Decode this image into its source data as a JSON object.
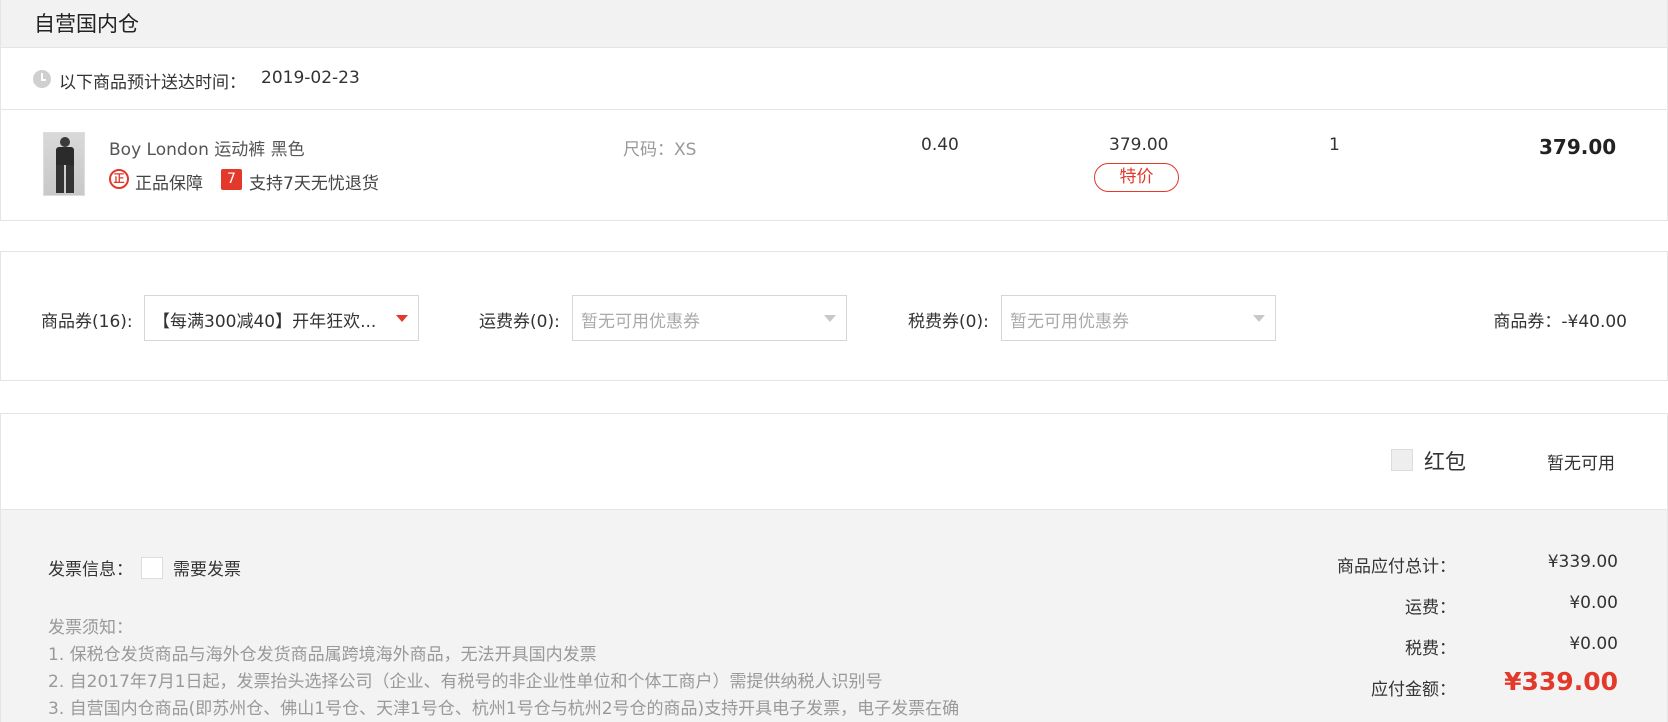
{
  "warehouse": {
    "title": "自营国内仓"
  },
  "delivery": {
    "label": "以下商品预计送达时间：",
    "date": "2019-02-23"
  },
  "product": {
    "name": "Boy London 运动裤 黑色",
    "guarantee_icon": "正",
    "guarantee_label": "正品保障",
    "return_icon": "7",
    "return_label": "支持7天无忧退货",
    "size": "尺码：XS",
    "weight": "0.40",
    "unit_price": "379.00",
    "special_badge": "特价",
    "quantity": "1",
    "total": "379.00"
  },
  "coupons": {
    "goods": {
      "label": "商品券(16):",
      "value": "【每满300减40】开年狂欢..."
    },
    "shipping": {
      "label": "运费券(0):",
      "value": "暂无可用优惠券"
    },
    "tax": {
      "label": "税费券(0):",
      "value": "暂无可用优惠券"
    },
    "summary": "商品券：-¥40.00"
  },
  "red_packet": {
    "label": "红包",
    "status": "暂无可用"
  },
  "invoice": {
    "label": "发票信息：",
    "need_label": "需要发票",
    "notice_title": "发票须知：",
    "notices": [
      "1. 保税仓发货商品与海外仓发货商品属跨境海外商品，无法开具国内发票",
      "2. 自2017年7月1日起，发票抬头选择公司（企业、有税号的非企业性单位和个体工商户）需提供纳税人识别号",
      "3. 自营国内仓商品(即苏州仓、佛山1号仓、天津1号仓、杭州1号仓与杭州2号仓的商品)支持开具电子发票，电子发票在确"
    ]
  },
  "summary": {
    "goods_total_label": "商品应付总计：",
    "goods_total_value": "¥339.00",
    "shipping_label": "运费：",
    "shipping_value": "¥0.00",
    "tax_label": "税费：",
    "tax_value": "¥0.00",
    "payable_label": "应付金额：",
    "payable_value": "¥339.00"
  },
  "colors": {
    "accent": "#e2392b",
    "muted_text": "#999999",
    "panel_bg": "#f3f3f3"
  }
}
